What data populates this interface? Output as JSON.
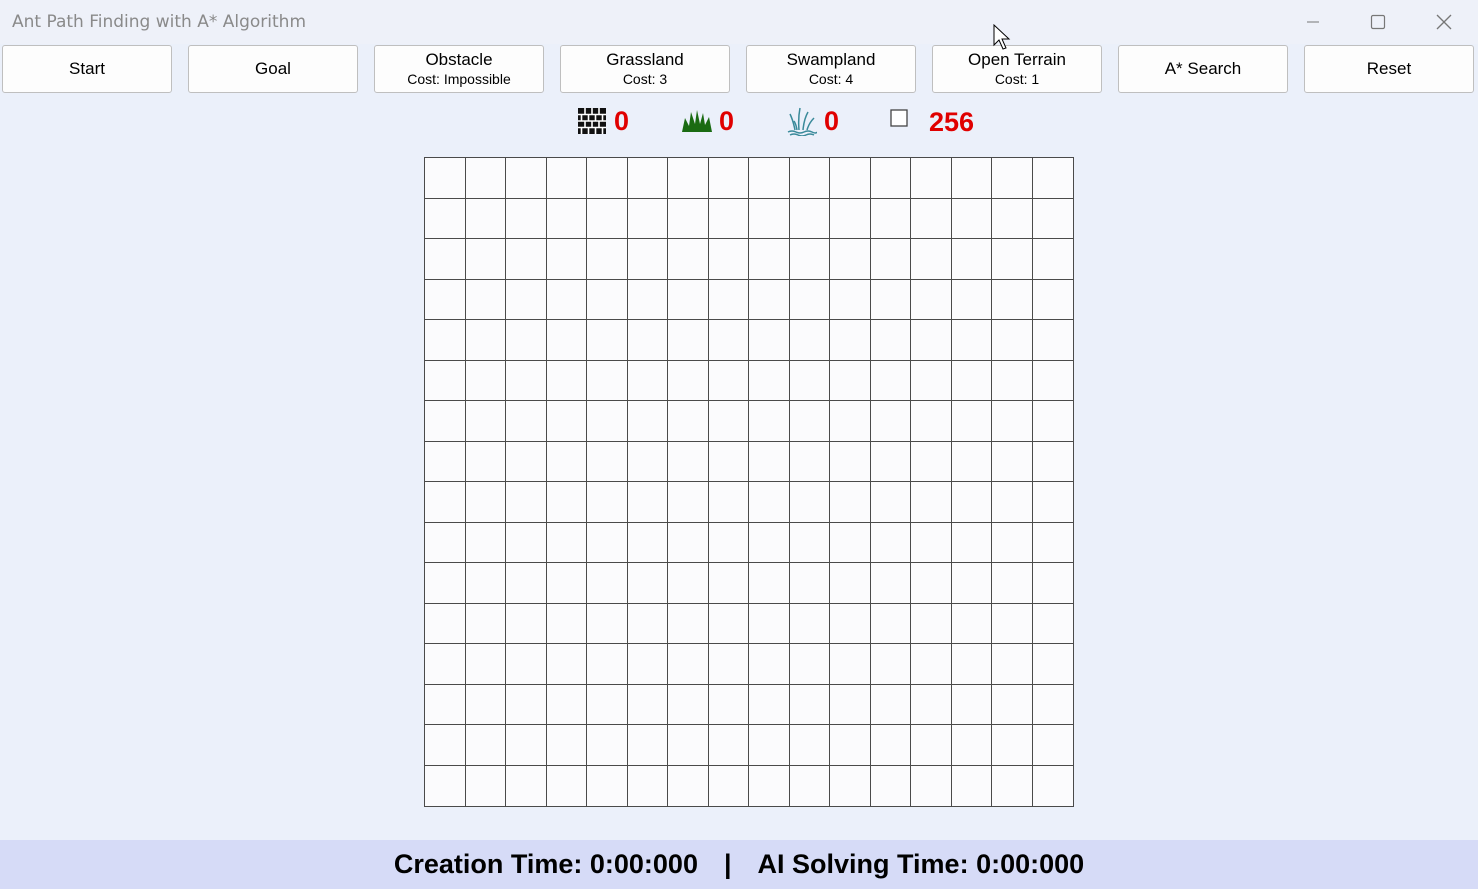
{
  "window": {
    "title": "Ant Path Finding with A* Algorithm",
    "controls": [
      "minimize",
      "maximize",
      "close"
    ]
  },
  "toolbar": [
    {
      "key": "start",
      "label": "Start",
      "cost": ""
    },
    {
      "key": "goal",
      "label": "Goal",
      "cost": ""
    },
    {
      "key": "obstacle",
      "label": "Obstacle",
      "cost": "Cost: Impossible"
    },
    {
      "key": "grassland",
      "label": "Grassland",
      "cost": "Cost: 3"
    },
    {
      "key": "swampland",
      "label": "Swampland",
      "cost": "Cost: 4"
    },
    {
      "key": "open-terrain",
      "label": "Open Terrain",
      "cost": "Cost: 1"
    },
    {
      "key": "a-star-search",
      "label": "A* Search",
      "cost": ""
    },
    {
      "key": "reset",
      "label": "Reset",
      "cost": ""
    }
  ],
  "counters": {
    "obstacle": {
      "icon": "brick-wall-icon",
      "value": "0"
    },
    "grassland": {
      "icon": "grass-icon",
      "value": "0"
    },
    "swampland": {
      "icon": "swamp-reeds-icon",
      "value": "0"
    },
    "open_terrain": {
      "icon": "empty-square-icon",
      "value": "256"
    }
  },
  "grid": {
    "rows": 16,
    "cols": 16
  },
  "status": {
    "creation_time": "Creation Time: 0:00:000",
    "separator": "|",
    "solving_time": "AI Solving Time: 0:00:000"
  },
  "colors": {
    "background": "#ebf0fa",
    "status_bar": "#d6dbf7",
    "counter_value": "#e00000",
    "grass_icon": "#1a6b12",
    "swamp_icon": "#3a8a9a"
  }
}
